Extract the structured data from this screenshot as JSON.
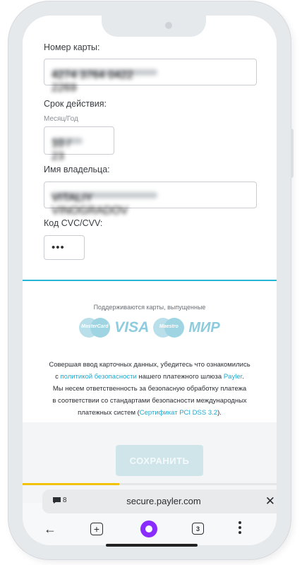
{
  "form": {
    "card_number_label": "Номер карты:",
    "card_number_value": "4274 3764 0422 2269",
    "expiry_label": "Срок действия:",
    "expiry_sublabel": "Месяц/Год",
    "expiry_value": "10 / 23",
    "holder_label": "Имя владельца:",
    "holder_value": "VITALIY VINOGRADOV",
    "cvc_label": "Код CVC/CVV:",
    "cvc_value": "•••"
  },
  "info": {
    "supported_text": "Поддерживаются карты, выпущенные",
    "logos": [
      "MasterCard",
      "VISA",
      "Maestro",
      "МИР"
    ],
    "desc_1": "Совершая ввод карточных данных, убедитесь что ознакомились",
    "desc_2a": "с ",
    "desc_2_link": "политикой безопасности",
    "desc_2b": " нашего платежного шлюза ",
    "desc_2_brand": "Payler",
    "desc_2c": ".",
    "desc_3": "Мы несем ответственность за безопасную обработку платежа",
    "desc_4": "в соответствии со стандартами безопасности международных",
    "desc_5a": "платежных систем (",
    "desc_5_link": "Сертификат PCI DSS 3.2",
    "desc_5b": ")."
  },
  "actions": {
    "save_label": "СОХРАНИТЬ"
  },
  "browser": {
    "progress": 0.38,
    "tabs_count_indicator": "8",
    "url": "secure.payler.com",
    "close_icon": "close-icon",
    "open_tabs_count": "3",
    "colors": {
      "accent": "#27b6d8",
      "progress": "#f2c200",
      "alice": "#8a2cff"
    }
  }
}
